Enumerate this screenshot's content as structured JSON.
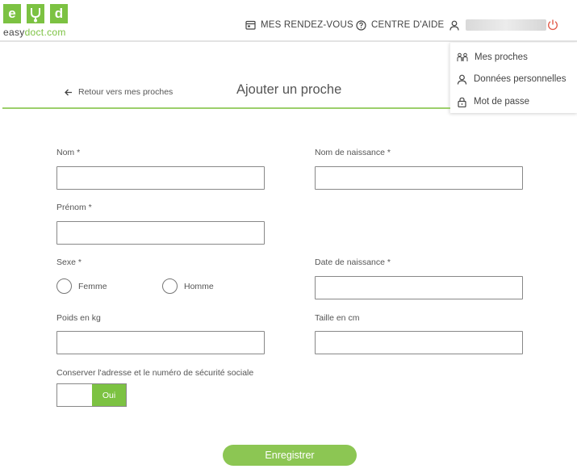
{
  "logo": {
    "letters": [
      "e",
      "",
      "d"
    ],
    "name_prefix": "easy",
    "name_accent": "doct",
    "name_suffix": ".com"
  },
  "header": {
    "rendez_vous_label": "MES RENDEZ-VOUS",
    "aide_label": "CENTRE D'AIDE",
    "accent_color": "#7cc242",
    "power_color": "#e25b4a"
  },
  "dropdown": {
    "items": [
      {
        "label": "Mes proches",
        "icon": "family-icon"
      },
      {
        "label": "Données personnelles",
        "icon": "person-icon"
      },
      {
        "label": "Mot de passe",
        "icon": "lock-icon"
      }
    ]
  },
  "page": {
    "back_label": "Retour vers mes proches",
    "title": "Ajouter un proche"
  },
  "form": {
    "nom_label": "Nom *",
    "nom_value": "",
    "nom_naissance_label": "Nom de naissance *",
    "nom_naissance_value": "",
    "prenom_label": "Prénom *",
    "prenom_value": "",
    "sexe_label": "Sexe *",
    "sexe_options": [
      "Femme",
      "Homme"
    ],
    "date_naissance_label": "Date de naissance *",
    "date_naissance_value": "",
    "poids_label": "Poids en kg",
    "poids_value": "",
    "taille_label": "Taille en cm",
    "taille_value": "",
    "conserver_label": "Conserver l'adresse et le numéro de sécurité sociale",
    "toggle_on_label": "Oui",
    "save_label": "Enregistrer"
  }
}
